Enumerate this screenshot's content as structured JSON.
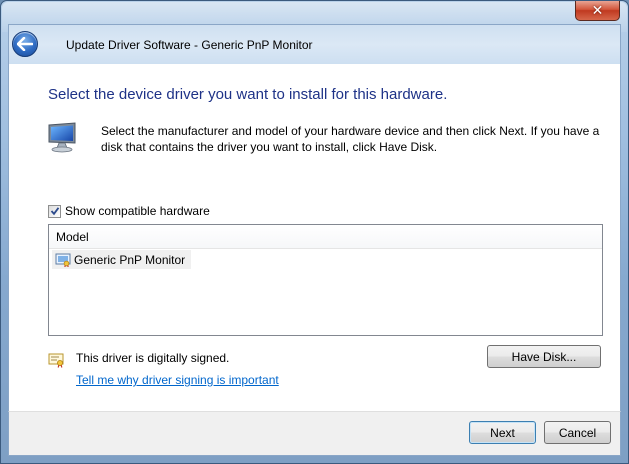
{
  "window": {
    "title": "Update Driver Software - Generic PnP Monitor",
    "close_glyph": "✕"
  },
  "content": {
    "heading": "Select the device driver you want to install for this hardware.",
    "instructions": "Select the manufacturer and model of your hardware device and then click Next. If you have a disk that contains the driver you want to install, click Have Disk.",
    "show_compatible_label": "Show compatible hardware",
    "show_compatible_checked": true,
    "model_list": {
      "header": "Model",
      "items": [
        {
          "label": "Generic PnP Monitor",
          "icon": "driver-certificate-icon",
          "selected": true
        }
      ]
    },
    "signed_text": "This driver is digitally signed.",
    "signing_link": "Tell me why driver signing is important",
    "have_disk_label": "Have Disk..."
  },
  "footer": {
    "next_label": "Next",
    "cancel_label": "Cancel"
  },
  "colors": {
    "heading": "#1e3287",
    "link": "#0066cc",
    "close": "#c03920"
  }
}
